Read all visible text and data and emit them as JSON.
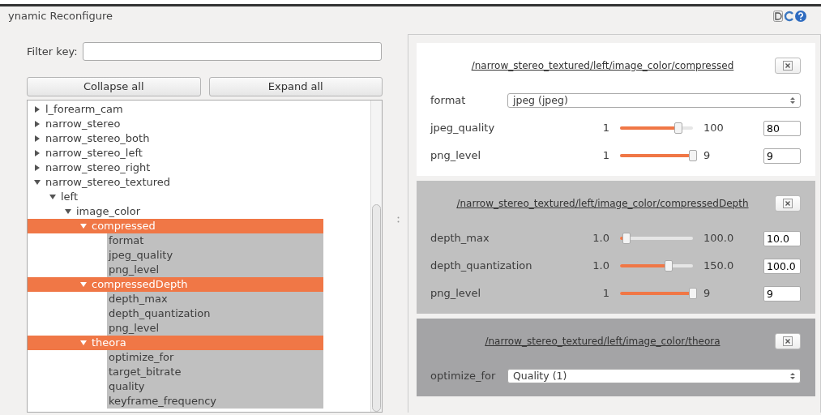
{
  "window": {
    "title": "ynamic Reconfigure"
  },
  "filter": {
    "label": "Filter key:"
  },
  "buttons": [
    "Collapse all",
    "Expand all"
  ],
  "tree": [
    {
      "label": "l_forearm_cam",
      "expanded": false,
      "selected": false
    },
    {
      "label": "narrow_stereo",
      "expanded": false,
      "selected": false
    },
    {
      "label": "narrow_stereo_both",
      "expanded": false,
      "selected": false
    },
    {
      "label": "narrow_stereo_left",
      "expanded": false,
      "selected": false
    },
    {
      "label": "narrow_stereo_right",
      "expanded": false,
      "selected": false
    },
    {
      "label": "narrow_stereo_textured",
      "expanded": true,
      "selected": false,
      "children": [
        {
          "label": "left",
          "expanded": true,
          "selected": false,
          "children": [
            {
              "label": "image_color",
              "expanded": true,
              "selected": false,
              "children": [
                {
                  "label": "compressed",
                  "expanded": true,
                  "selected": true,
                  "children": [
                    {
                      "label": "format",
                      "selected": true
                    },
                    {
                      "label": "jpeg_quality",
                      "selected": true
                    },
                    {
                      "label": "png_level",
                      "selected": true
                    }
                  ]
                },
                {
                  "label": "compressedDepth",
                  "expanded": true,
                  "selected": true,
                  "children": [
                    {
                      "label": "depth_max",
                      "selected": true
                    },
                    {
                      "label": "depth_quantization",
                      "selected": true
                    },
                    {
                      "label": "png_level",
                      "selected": true
                    }
                  ]
                },
                {
                  "label": "theora",
                  "expanded": true,
                  "selected": true,
                  "children": [
                    {
                      "label": "optimize_for",
                      "selected": true
                    },
                    {
                      "label": "target_bitrate",
                      "selected": true
                    },
                    {
                      "label": "quality",
                      "selected": true
                    },
                    {
                      "label": "keyframe_frequency",
                      "selected": true
                    }
                  ]
                }
              ]
            }
          ]
        }
      ]
    }
  ],
  "panels": [
    {
      "title": "/narrow_stereo_textured/left/image_color/compressed",
      "color": "#ffffff",
      "params": [
        {
          "kind": "enum",
          "name": "format",
          "value": "jpeg (jpeg)"
        },
        {
          "kind": "slider",
          "name": "jpeg_quality",
          "min": "1",
          "max": "100",
          "level": 0.8,
          "value": "80"
        },
        {
          "kind": "slider",
          "name": "png_level",
          "min": "1",
          "max": "9",
          "level": 1,
          "value": "9"
        }
      ]
    },
    {
      "title": "/narrow_stereo_textured/left/image_color/compressedDepth",
      "color": "#c0c0c0",
      "params": [
        {
          "kind": "slider",
          "name": "depth_max",
          "min": "1.0",
          "max": "100.0",
          "level": 0.09,
          "value": "10.0"
        },
        {
          "kind": "slider",
          "name": "depth_quantization",
          "min": "1.0",
          "max": "150.0",
          "level": 0.67,
          "value": "100.0"
        },
        {
          "kind": "slider",
          "name": "png_level",
          "min": "1",
          "max": "9",
          "level": 1,
          "value": "9"
        }
      ]
    },
    {
      "title": "/narrow_stereo_textured/left/image_color/theora",
      "color": "#a4a4a6",
      "params": [
        {
          "kind": "enum",
          "name": "optimize_for",
          "value": "Quality (1)"
        }
      ]
    }
  ]
}
